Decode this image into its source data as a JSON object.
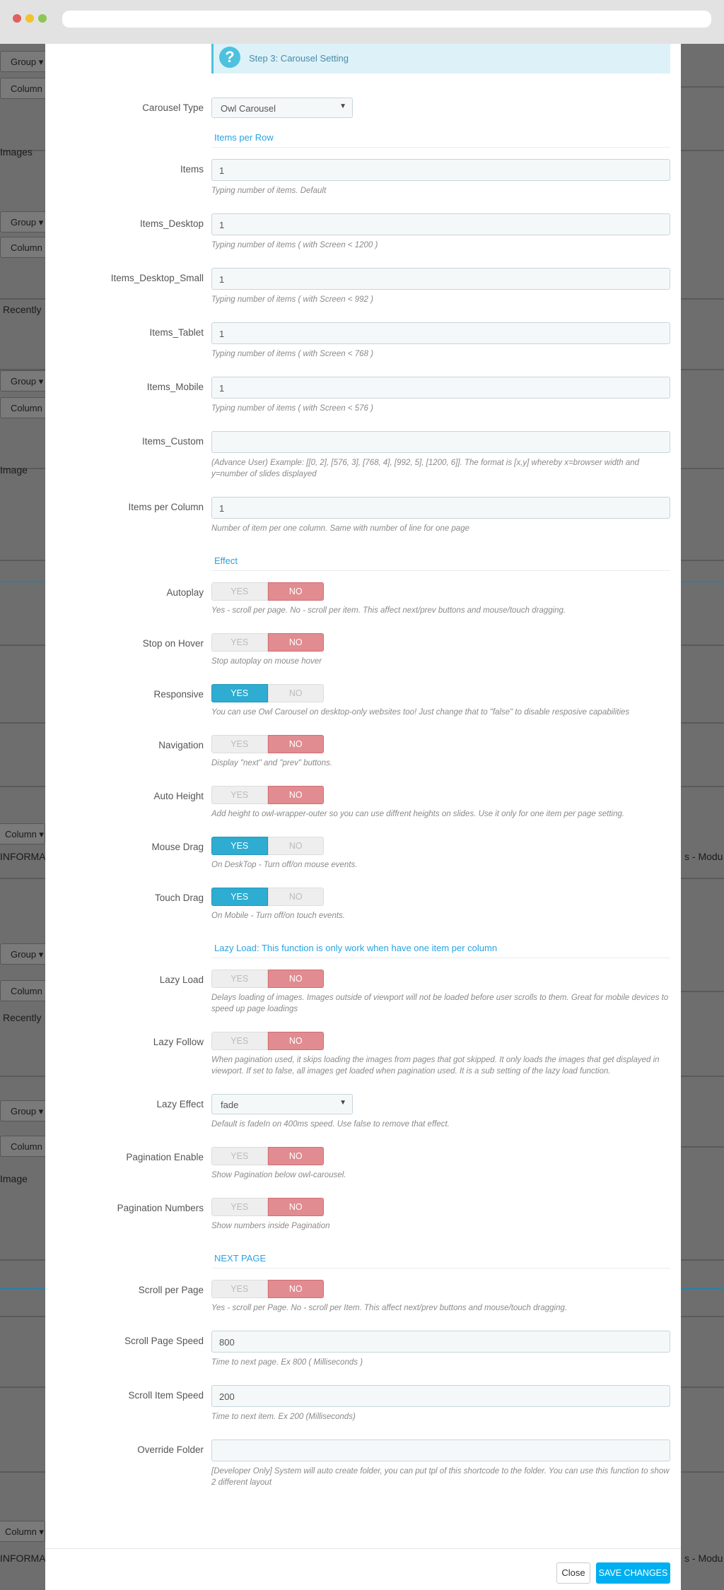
{
  "browser": {
    "dot_colors": [
      "#e0605e",
      "#f2c230",
      "#8cc751"
    ],
    "url": ""
  },
  "background_fragments": [
    "Group ▾",
    "Column",
    "Images",
    "Group ▾",
    "Column",
    "Recently",
    "Group ▾",
    "Column",
    "Image",
    "Column ▾",
    "INFORMAT",
    "s - Modu",
    "Group ▾",
    "Column",
    "Recently",
    "Group ▾",
    "Column",
    "Image",
    "Column ▾",
    "INFORMAT",
    "s - Modu"
  ],
  "step_header": {
    "icon": "question-circle-icon",
    "title": "Step 3: Carousel Setting"
  },
  "colors": {
    "accent": "#27a3e3",
    "yes_active": "#2eacd1",
    "no_active": "#e08c90",
    "save": "#00aff0"
  },
  "fields": [
    {
      "type": "select",
      "label": "Carousel Type",
      "value": "Owl Carousel"
    },
    {
      "type": "section",
      "label": "Items per Row"
    },
    {
      "type": "text",
      "label": "Items",
      "value": "1",
      "help": "Typing number of items. Default"
    },
    {
      "type": "text",
      "label": "Items_Desktop",
      "value": "1",
      "help": "Typing number of items ( with Screen < 1200 )"
    },
    {
      "type": "text",
      "label": "Items_Desktop_Small",
      "value": "1",
      "help": "Typing number of items ( with Screen < 992 )"
    },
    {
      "type": "text",
      "label": "Items_Tablet",
      "value": "1",
      "help": "Typing number of items ( with Screen < 768 )"
    },
    {
      "type": "text",
      "label": "Items_Mobile",
      "value": "1",
      "help": "Typing number of items ( with Screen < 576 )"
    },
    {
      "type": "text",
      "label": "Items_Custom",
      "value": "",
      "help": "(Advance User) Example: [[0, 2], [576, 3], [768, 4], [992, 5], [1200, 6]]. The format is [x,y] whereby x=browser width and y=number of slides displayed"
    },
    {
      "type": "text",
      "label": "Items per Column",
      "value": "1",
      "help": "Number of item per one column. Same with number of line for one page"
    },
    {
      "type": "section",
      "label": "Effect"
    },
    {
      "type": "toggle",
      "label": "Autoplay",
      "value": "NO",
      "yes": "YES",
      "no": "NO",
      "help": "Yes - scroll per page. No - scroll per item. This affect next/prev buttons and mouse/touch dragging."
    },
    {
      "type": "toggle",
      "label": "Stop on Hover",
      "value": "NO",
      "yes": "YES",
      "no": "NO",
      "help": "Stop autoplay on mouse hover"
    },
    {
      "type": "toggle",
      "label": "Responsive",
      "value": "YES",
      "yes": "YES",
      "no": "NO",
      "help": "You can use Owl Carousel on desktop-only websites too! Just change that to \"false\" to disable resposive capabilities"
    },
    {
      "type": "toggle",
      "label": "Navigation",
      "value": "NO",
      "yes": "YES",
      "no": "NO",
      "help": "Display \"next\" and \"prev\" buttons."
    },
    {
      "type": "toggle",
      "label": "Auto Height",
      "value": "NO",
      "yes": "YES",
      "no": "NO",
      "help": "Add height to owl-wrapper-outer so you can use diffrent heights on slides. Use it only for one item per page setting."
    },
    {
      "type": "toggle",
      "label": "Mouse Drag",
      "value": "YES",
      "yes": "YES",
      "no": "NO",
      "help": "On DeskTop - Turn off/on mouse events."
    },
    {
      "type": "toggle",
      "label": "Touch Drag",
      "value": "YES",
      "yes": "YES",
      "no": "NO",
      "help": "On Mobile - Turn off/on touch events."
    },
    {
      "type": "section",
      "label": "Lazy Load: This function is only work when have one item per column"
    },
    {
      "type": "toggle",
      "label": "Lazy Load",
      "value": "NO",
      "yes": "YES",
      "no": "NO",
      "help": "Delays loading of images. Images outside of viewport will not be loaded before user scrolls to them. Great for mobile devices to speed up page loadings"
    },
    {
      "type": "toggle",
      "label": "Lazy Follow",
      "value": "NO",
      "yes": "YES",
      "no": "NO",
      "help": "When pagination used, it skips loading the images from pages that got skipped. It only loads the images that get displayed in viewport. If set to false, all images get loaded when pagination used. It is a sub setting of the lazy load function."
    },
    {
      "type": "select",
      "label": "Lazy Effect",
      "value": "fade",
      "help": "Default is fadeIn on 400ms speed. Use false to remove that effect."
    },
    {
      "type": "toggle",
      "label": "Pagination Enable",
      "value": "NO",
      "yes": "YES",
      "no": "NO",
      "help": "Show Pagination below owl-carousel."
    },
    {
      "type": "toggle",
      "label": "Pagination Numbers",
      "value": "NO",
      "yes": "YES",
      "no": "NO",
      "help": "Show numbers inside Pagination"
    },
    {
      "type": "section",
      "label": "NEXT PAGE"
    },
    {
      "type": "toggle",
      "label": "Scroll per Page",
      "value": "NO",
      "yes": "YES",
      "no": "NO",
      "help": "Yes - scroll per Page. No - scroll per Item. This affect next/prev buttons and mouse/touch dragging."
    },
    {
      "type": "text",
      "label": "Scroll Page Speed",
      "value": "800",
      "help": "Time to next page. Ex 800 ( Milliseconds )"
    },
    {
      "type": "text",
      "label": "Scroll Item Speed",
      "value": "200",
      "help": "Time to next item. Ex 200 (Milliseconds)"
    },
    {
      "type": "text",
      "label": "Override Folder",
      "value": "",
      "help": "[Developer Only] System will auto create folder, you can put tpl of this shortcode to the folder. You can use this function to show 2 different layout"
    }
  ],
  "footer": {
    "close_label": "Close",
    "save_label": "SAVE CHANGES"
  }
}
